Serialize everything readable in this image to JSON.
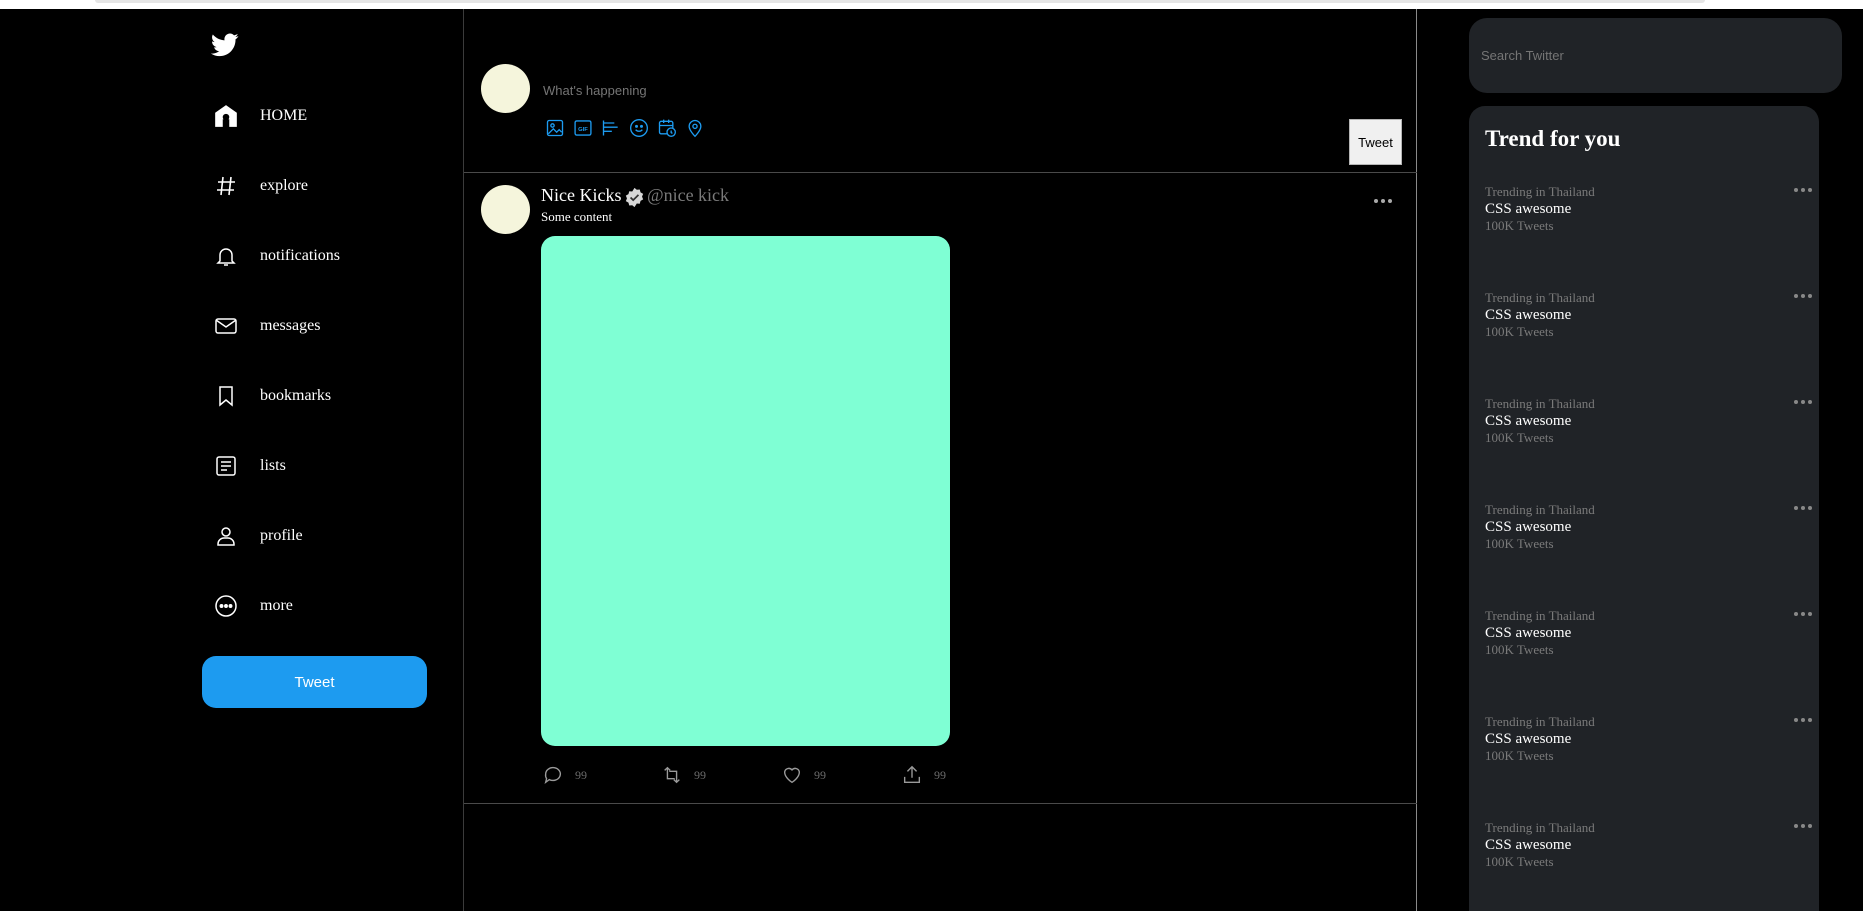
{
  "sidebar": {
    "logo": "twitter-bird-icon",
    "items": [
      {
        "label": "HOME",
        "icon": "home-icon"
      },
      {
        "label": "explore",
        "icon": "hashtag-icon"
      },
      {
        "label": "notifications",
        "icon": "bell-icon"
      },
      {
        "label": "messages",
        "icon": "mail-icon"
      },
      {
        "label": "bookmarks",
        "icon": "bookmark-icon"
      },
      {
        "label": "lists",
        "icon": "list-icon"
      },
      {
        "label": "profile",
        "icon": "person-icon"
      },
      {
        "label": "more",
        "icon": "more-circle-icon"
      }
    ],
    "tweet_button": "Tweet"
  },
  "composer": {
    "placeholder": "What's happening",
    "tools": [
      "image-icon",
      "gif-icon",
      "poll-icon",
      "emoji-icon",
      "schedule-icon",
      "location-icon"
    ],
    "tweet_button": "Tweet"
  },
  "post": {
    "name": "Nice Kicks",
    "handle": "@nice kick",
    "content": "Some content",
    "media_color": "#7fffd4",
    "actions": [
      {
        "icon": "reply-icon",
        "count": "99"
      },
      {
        "icon": "retweet-icon",
        "count": "99"
      },
      {
        "icon": "like-icon",
        "count": "99"
      },
      {
        "icon": "share-icon",
        "count": "99"
      }
    ]
  },
  "search": {
    "placeholder": "Search Twitter"
  },
  "trends": {
    "title": "Trend for you",
    "items": [
      {
        "location": "Trending in Thailand",
        "name": "CSS awesome",
        "count": "100K Tweets"
      },
      {
        "location": "Trending in Thailand",
        "name": "CSS awesome",
        "count": "100K Tweets"
      },
      {
        "location": "Trending in Thailand",
        "name": "CSS awesome",
        "count": "100K Tweets"
      },
      {
        "location": "Trending in Thailand",
        "name": "CSS awesome",
        "count": "100K Tweets"
      },
      {
        "location": "Trending in Thailand",
        "name": "CSS awesome",
        "count": "100K Tweets"
      },
      {
        "location": "Trending in Thailand",
        "name": "CSS awesome",
        "count": "100K Tweets"
      },
      {
        "location": "Trending in Thailand",
        "name": "CSS awesome",
        "count": "100K Tweets"
      }
    ]
  },
  "colors": {
    "accent": "#1d9bf0",
    "panel": "#202327",
    "background": "#000000"
  }
}
